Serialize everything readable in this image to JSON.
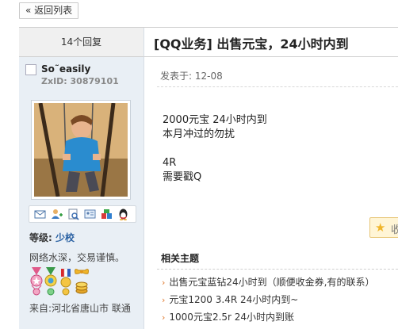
{
  "nav": {
    "back_label": "« 返回列表"
  },
  "thread": {
    "reply_count": "14个回复",
    "title": "[QQ业务] 出售元宝，24小时内到"
  },
  "user": {
    "name": "So˜easily",
    "zxid": "ZxID:  30879101",
    "level_label": "等级:",
    "level_value": "少校",
    "motto": "网络水深，交易谨慎。",
    "from": "来自:河北省唐山市 联通",
    "action_icons": [
      "mail-icon",
      "add-friend-icon",
      "search-posts-icon",
      "profile-card-icon",
      "gift-icon",
      "qq-penguin-icon"
    ],
    "medals": [
      "pink-medal-icon",
      "green-medal-icon",
      "flag-medal-icon",
      "bow-medal-icon",
      "coin-stack-medal-icon"
    ]
  },
  "post": {
    "posted_at": "发表于: 12-08",
    "lines": [
      "2000元宝 24小时内到",
      "本月冲过的勿扰",
      "",
      "4R",
      "需要戳Q"
    ]
  },
  "favorite": {
    "label": "收",
    "icon": "star-icon",
    "color": "#f0b52a"
  },
  "related": {
    "title": "相关主题",
    "items": [
      "出售元宝蓝钻24小时到（顺便收金券,有的联系）",
      "元宝1200 3.4R 24小时内到~",
      "1000元宝2.5r      24小时内到账"
    ]
  },
  "colors": {
    "sidebar_bg": "#e9eff5",
    "level_color": "#2a61a3",
    "arrow_color": "#e07a2e"
  }
}
